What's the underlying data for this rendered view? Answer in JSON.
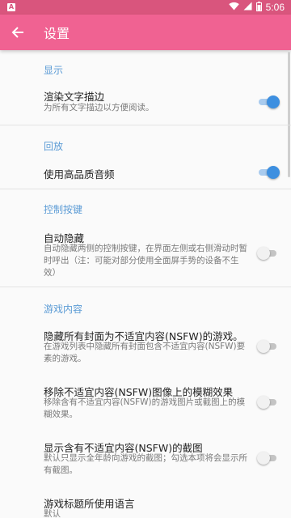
{
  "status_bar": {
    "time": "5:06",
    "app_icon": "A",
    "icons": [
      "wifi-icon",
      "signal-icon",
      "battery-icon"
    ]
  },
  "toolbar": {
    "title": "设置",
    "back_icon": "arrow-left-icon"
  },
  "sections": [
    {
      "header": "显示",
      "items": [
        {
          "title": "渲染文字描边",
          "subtitle": "为所有文字描边以方便阅读。",
          "checked": true
        }
      ]
    },
    {
      "header": "回放",
      "items": [
        {
          "title": "使用高品质音频",
          "subtitle": "",
          "checked": true
        }
      ]
    },
    {
      "header": "控制按键",
      "items": [
        {
          "title": "自动隐藏",
          "subtitle": "自动隐藏两侧的控制按键，在界面左侧或右侧滑动时暂时呼出（注：可能对部分使用全面屏手势的设备不生效）",
          "checked": false
        }
      ]
    },
    {
      "header": "游戏内容",
      "items": [
        {
          "title": "隐藏所有封面为不适宜内容(NSFW)的游戏。",
          "subtitle": "在游戏列表中隐藏所有封面包含不适宜内容(NSFW)要素的游戏。",
          "checked": false
        },
        {
          "title": "移除不适宜内容(NSFW)图像上的模糊效果",
          "subtitle": "移除含有不适宜内容(NSFW)的游戏图片或截图上的模糊效果。",
          "checked": false
        },
        {
          "title": "显示含有不适宜内容(NSFW)的截图",
          "subtitle": "默认只显示全年龄向游戏的截图；勾选本项将会显示所有截图。",
          "checked": false
        },
        {
          "title": "游戏标题所使用语言",
          "subtitle": "默认",
          "checked": null
        }
      ]
    }
  ],
  "colors": {
    "status_bar": "#d9557d",
    "toolbar": "#f06292",
    "accent": "#3d8fe0",
    "section_header": "#5b9bd5"
  }
}
